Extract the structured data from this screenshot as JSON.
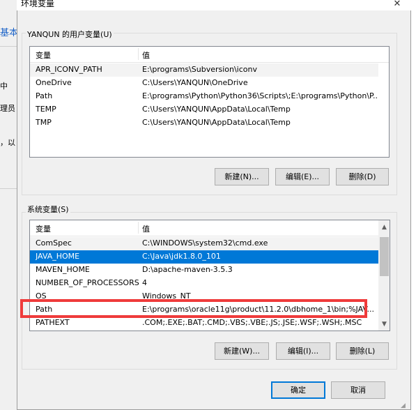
{
  "background_window": {
    "fragments": [
      "基本",
      "中",
      "理员",
      "，以"
    ]
  },
  "dialog": {
    "title": "环境变量",
    "close_glyph": "✕"
  },
  "user_vars": {
    "group_label": "YANQUN 的用户变量(U)",
    "columns": [
      "变量",
      "值"
    ],
    "rows": [
      {
        "name": "APR_ICONV_PATH",
        "value": "E:\\programs\\Subversion\\iconv"
      },
      {
        "name": "OneDrive",
        "value": "C:\\Users\\YANQUN\\OneDrive"
      },
      {
        "name": "Path",
        "value": "E:\\programs\\Python\\Python36\\Scripts\\;E:\\programs\\Python\\P..."
      },
      {
        "name": "TEMP",
        "value": "C:\\Users\\YANQUN\\AppData\\Local\\Temp"
      },
      {
        "name": "TMP",
        "value": "C:\\Users\\YANQUN\\AppData\\Local\\Temp"
      }
    ],
    "buttons": {
      "new": "新建(N)...",
      "edit": "编辑(E)...",
      "delete": "删除(D)"
    }
  },
  "system_vars": {
    "group_label": "系统变量(S)",
    "columns": [
      "变量",
      "值"
    ],
    "rows": [
      {
        "name": "ComSpec",
        "value": "C:\\WINDOWS\\system32\\cmd.exe"
      },
      {
        "name": "JAVA_HOME",
        "value": "C:\\Java\\jdk1.8.0_101"
      },
      {
        "name": "MAVEN_HOME",
        "value": "D:\\apache-maven-3.5.3"
      },
      {
        "name": "NUMBER_OF_PROCESSORS",
        "value": "4"
      },
      {
        "name": "OS",
        "value": "Windows_NT"
      },
      {
        "name": "Path",
        "value": "E:\\programs\\oracle11g\\product\\11.2.0\\dbhome_1\\bin;%JAV..."
      },
      {
        "name": "PATHEXT",
        "value": ".COM;.EXE;.BAT;.CMD;.VBS;.VBE;.JS;.JSE;.WSF;.WSH;.MSC"
      }
    ],
    "selected_row": "JAVA_HOME",
    "highlighted_row": "Path",
    "buttons": {
      "new": "新建(W)...",
      "edit": "编辑(I)...",
      "delete": "删除(L)"
    }
  },
  "footer": {
    "ok": "确定",
    "cancel": "取消"
  },
  "colors": {
    "selection": "#0078d7",
    "highlight_box": "#ef3b3b",
    "default_button_border": "#0078d7"
  },
  "icons": {
    "scroll_up": "▲",
    "scroll_down": "▼",
    "resize_grip": "◢"
  }
}
